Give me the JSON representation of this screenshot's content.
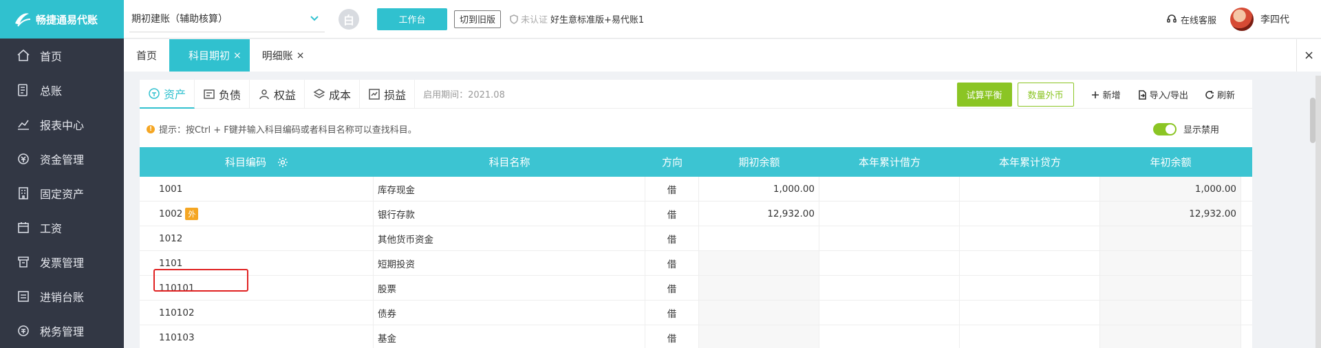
{
  "brand": {
    "name": "畅捷通易代账"
  },
  "sidebar": {
    "items": [
      {
        "label": "首页",
        "icon": "home-icon"
      },
      {
        "label": "总账",
        "icon": "ledger-icon"
      },
      {
        "label": "报表中心",
        "icon": "chart-icon"
      },
      {
        "label": "资金管理",
        "icon": "money-icon"
      },
      {
        "label": "固定资产",
        "icon": "building-icon"
      },
      {
        "label": "工资",
        "icon": "calendar-icon"
      },
      {
        "label": "发票管理",
        "icon": "invoice-icon"
      },
      {
        "label": "进销台账",
        "icon": "inventory-icon"
      },
      {
        "label": "税务管理",
        "icon": "tax-icon"
      }
    ]
  },
  "topbar": {
    "book_select": "期初建账（辅助核算）",
    "circle_btn": "白",
    "workbench": "工作台",
    "switch_old": "切到旧版",
    "cert_status": "未认证",
    "product": "好生意标准版+易代账1",
    "service": "在线客服",
    "user": "李四代"
  },
  "tabs": [
    {
      "label": "首页",
      "closable": false,
      "active": false
    },
    {
      "label": "科目期初",
      "closable": true,
      "active": true
    },
    {
      "label": "明细账",
      "closable": true,
      "active": false
    }
  ],
  "tab_close_icon": "×",
  "category_tabs": [
    {
      "label": "资产",
      "icon": "asset-icon",
      "active": true
    },
    {
      "label": "负债",
      "icon": "liability-icon",
      "active": false
    },
    {
      "label": "权益",
      "icon": "equity-icon",
      "active": false
    },
    {
      "label": "成本",
      "icon": "cost-icon",
      "active": false
    },
    {
      "label": "损益",
      "icon": "profit-icon",
      "active": false
    }
  ],
  "period": "启用期间：2021.08",
  "actions": {
    "trial_balance": "试算平衡",
    "fx_amount": "数量外币",
    "add": "新增",
    "import_export": "导入/导出",
    "refresh": "刷新"
  },
  "hint": "提示：按Ctrl + F键并输入科目编码或者科目名称可以查找科目。",
  "show_disabled": "显示禁用",
  "table": {
    "headers": [
      "科目编码",
      "科目名称",
      "方向",
      "期初余额",
      "本年累计借方",
      "本年累计贷方",
      "年初余额"
    ],
    "rows": [
      {
        "code": "1001",
        "fx": "",
        "name": "库存现金",
        "dir": "借",
        "opening": "1,000.00",
        "debit": "",
        "credit": "",
        "year_start": "1,000.00"
      },
      {
        "code": "1002",
        "fx": "外",
        "name": "银行存款",
        "dir": "借",
        "opening": "12,932.00",
        "debit": "",
        "credit": "",
        "year_start": "12,932.00"
      },
      {
        "code": "1012",
        "fx": "",
        "name": "其他货币资金",
        "dir": "借",
        "opening": "",
        "debit": "",
        "credit": "",
        "year_start": ""
      },
      {
        "code": "1101",
        "fx": "",
        "name": "短期投资",
        "dir": "借",
        "opening": "",
        "debit": "",
        "credit": "",
        "year_start": ""
      },
      {
        "code": "110101",
        "fx": "",
        "name": "股票",
        "dir": "借",
        "opening": "",
        "debit": "",
        "credit": "",
        "year_start": ""
      },
      {
        "code": "110102",
        "fx": "",
        "name": "债券",
        "dir": "借",
        "opening": "",
        "debit": "",
        "credit": "",
        "year_start": ""
      },
      {
        "code": "110103",
        "fx": "",
        "name": "基金",
        "dir": "借",
        "opening": "",
        "debit": "",
        "credit": "",
        "year_start": ""
      }
    ]
  },
  "colors": {
    "accent": "#30c1cf",
    "sidebar": "#323744",
    "green": "#8bc524",
    "warning": "#f5a623",
    "highlight": "#e02020"
  }
}
